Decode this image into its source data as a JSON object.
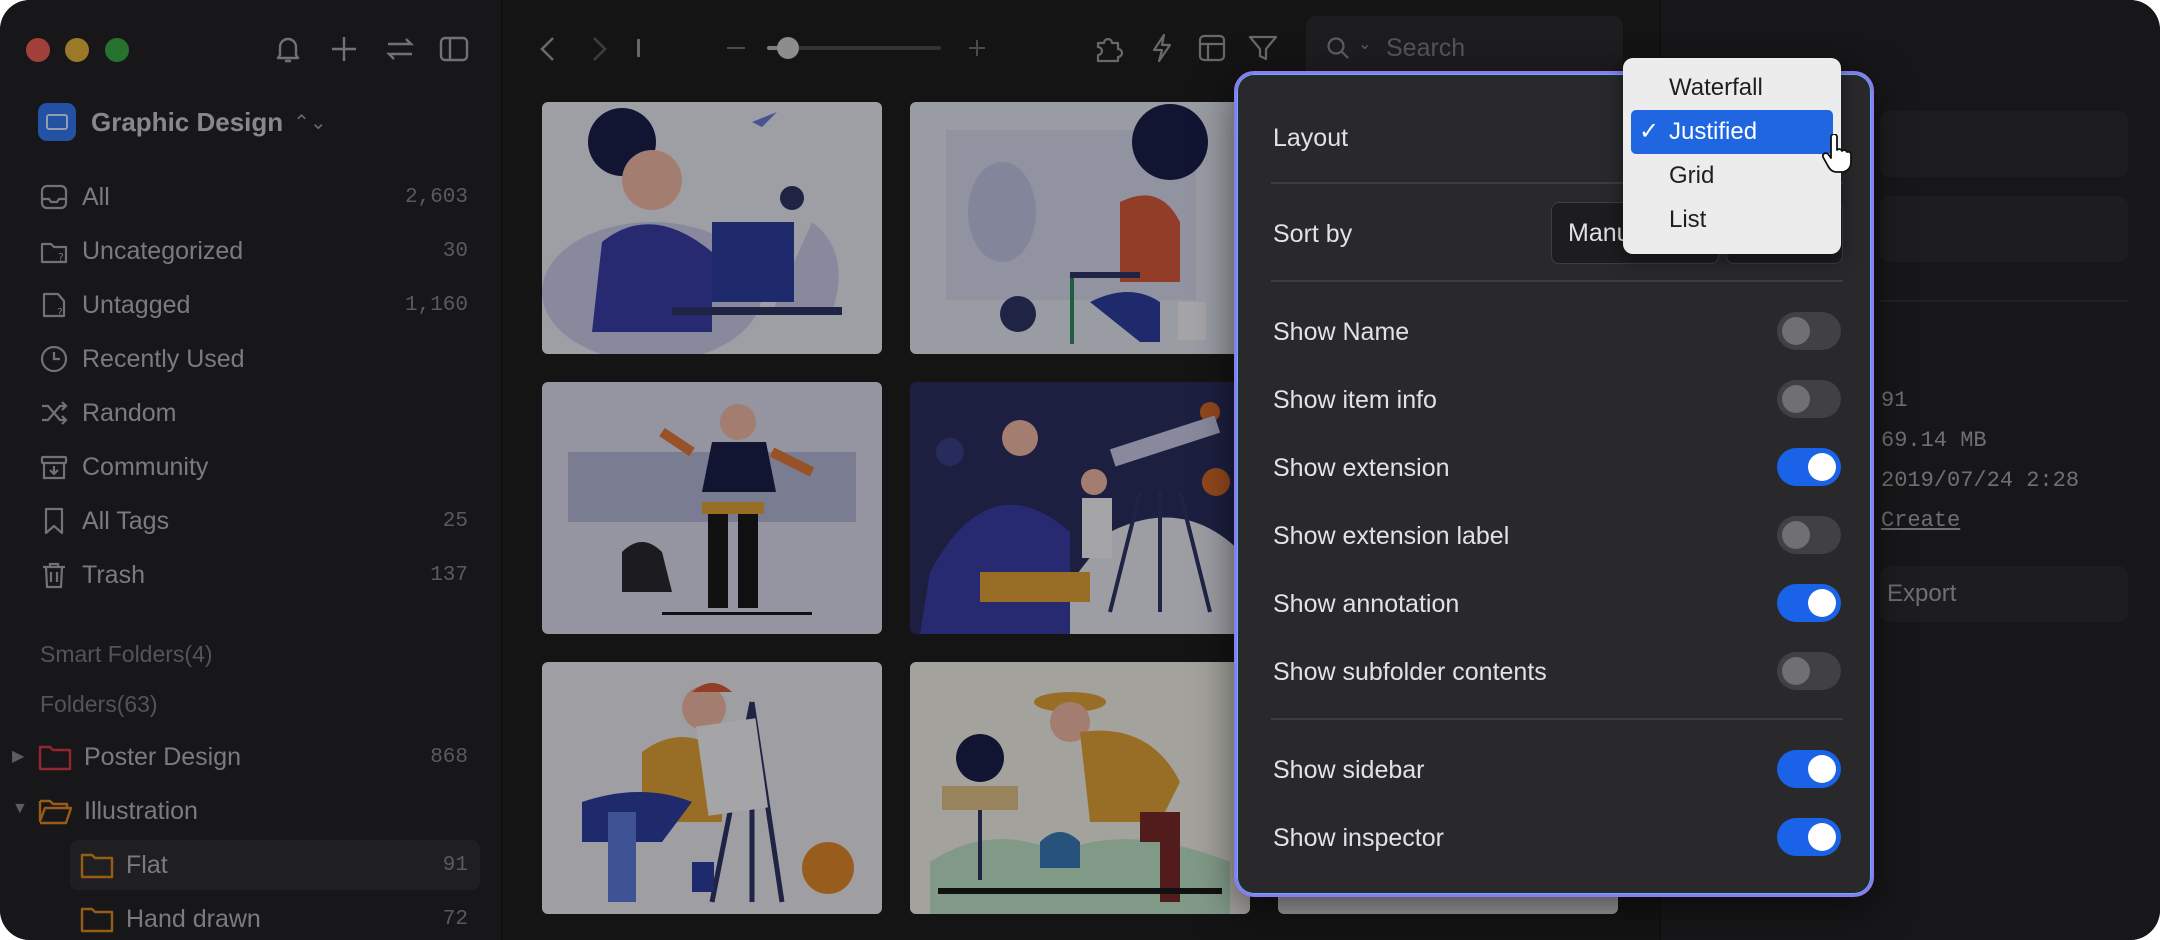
{
  "library": {
    "name": "Graphic Design",
    "chevron": "⌃⌄"
  },
  "nav": [
    {
      "label": "All",
      "count": "2,603",
      "icon": "inbox-icon"
    },
    {
      "label": "Uncategorized",
      "count": "30",
      "icon": "folder-question-icon"
    },
    {
      "label": "Untagged",
      "count": "1,160",
      "icon": "tag-question-icon"
    },
    {
      "label": "Recently Used",
      "count": "",
      "icon": "clock-icon"
    },
    {
      "label": "Random",
      "count": "",
      "icon": "shuffle-icon"
    },
    {
      "label": "Community",
      "count": "",
      "icon": "archive-icon"
    },
    {
      "label": "All Tags",
      "count": "25",
      "icon": "bookmark-icon"
    },
    {
      "label": "Trash",
      "count": "137",
      "icon": "trash-icon"
    }
  ],
  "smart_folders_label": "Smart Folders(4)",
  "folders_label": "Folders(63)",
  "folders": [
    {
      "label": "Poster Design",
      "count": "868",
      "color": "#d9394b"
    },
    {
      "label": "Illustration",
      "count": "",
      "color": "#e08a1f"
    },
    {
      "label": "Flat",
      "count": "91",
      "color": "#e08a1f"
    },
    {
      "label": "Hand drawn",
      "count": "72",
      "color": "#e08a1f"
    }
  ],
  "toolbar": {
    "search_placeholder": "Search",
    "zoom_level": 0.12
  },
  "inspector": {
    "values": [
      "91",
      "69.14 MB",
      "2019/07/24 2:28"
    ],
    "link": "Create",
    "export_label": "Export"
  },
  "popover": {
    "layout_label": "Layout",
    "sort_label": "Sort by",
    "sort_value": "Manual",
    "toggles": [
      {
        "label": "Show Name",
        "on": false
      },
      {
        "label": "Show item info",
        "on": false
      },
      {
        "label": "Show extension",
        "on": true
      },
      {
        "label": "Show extension label",
        "on": false
      },
      {
        "label": "Show annotation",
        "on": true
      },
      {
        "label": "Show subfolder contents",
        "on": false
      },
      {
        "label": "Show sidebar",
        "on": true
      },
      {
        "label": "Show inspector",
        "on": true
      }
    ]
  },
  "layout_menu": {
    "options": [
      "Waterfall",
      "Justified",
      "Grid",
      "List"
    ],
    "selected": "Justified",
    "check": "✓"
  },
  "colors": {
    "accent": "#1f66e0",
    "popover_border": "#8b7cf0"
  }
}
